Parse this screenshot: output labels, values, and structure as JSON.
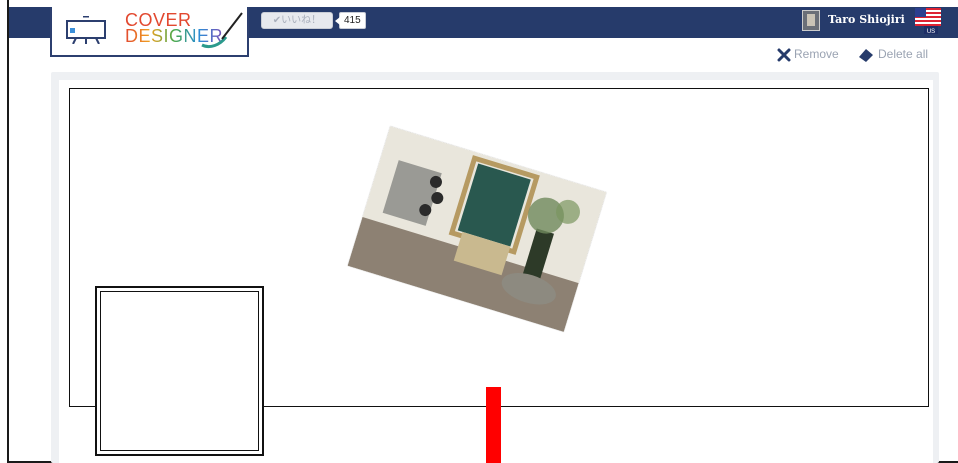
{
  "header": {
    "logo": {
      "line1": "COVER",
      "line2": "DESIGNER"
    },
    "like_button": {
      "label": "✔いいね！",
      "count": "415"
    },
    "user": {
      "name": "Taro Shiojiri"
    },
    "language_flag_label": "US"
  },
  "toolbar": {
    "remove_label": "Remove",
    "delete_all_label": "Delete all"
  },
  "canvas": {
    "photo": {
      "description_icon": "photo-of-chalkboard-and-wine-bottles"
    }
  },
  "colors": {
    "header_bg": "#263b6b",
    "accent_red": "#ff0000",
    "tool_text": "#9aa3b2"
  }
}
